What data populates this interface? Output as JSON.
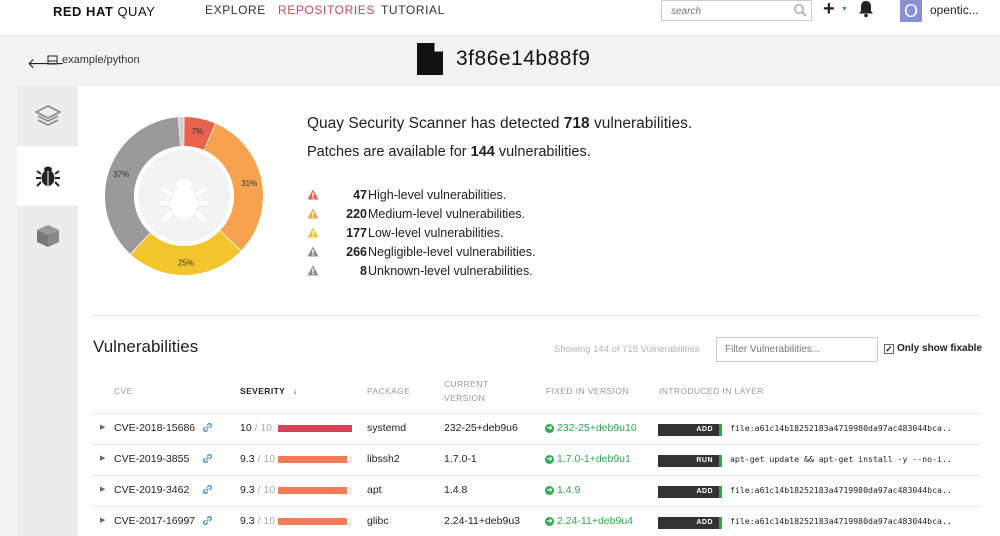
{
  "nav": {
    "brand_bold": "RED HAT",
    "brand_light": "QUAY",
    "links": [
      {
        "label": "EXPLORE",
        "active": false
      },
      {
        "label": "REPOSITORIES",
        "active": true
      },
      {
        "label": "TUTORIAL",
        "active": false
      }
    ],
    "search_placeholder": "search",
    "plus": "+",
    "avatar_letter": "O",
    "username": "opentic..."
  },
  "breadcrumb": {
    "repo": "example/python"
  },
  "tag": {
    "id": "3f86e14b88f9"
  },
  "summary": {
    "headline_prefix": "Quay Security Scanner has detected",
    "total": "718",
    "headline_suffix": "vulnerabilities.",
    "patches_prefix": "Patches are available for",
    "patches": "144",
    "patches_suffix": "vulnerabilities.",
    "levels": [
      {
        "count": "47",
        "label": "High-level vulnerabilities.",
        "color": "#e8624e"
      },
      {
        "count": "220",
        "label": "Medium-level vulnerabilities.",
        "color": "#f7a24f"
      },
      {
        "count": "177",
        "label": "Low-level vulnerabilities.",
        "color": "#f2c52d"
      },
      {
        "count": "266",
        "label": "Negligible-level vulnerabilities.",
        "color": "#8c8c8c"
      },
      {
        "count": "8",
        "label": "Unknown-level vulnerabilities.",
        "color": "#8c8c8c"
      }
    ]
  },
  "chart_data": {
    "type": "pie",
    "slices": [
      {
        "label": "7%",
        "value": 47,
        "color": "#e8624e"
      },
      {
        "label": "31%",
        "value": 220,
        "color": "#f7a24f"
      },
      {
        "label": "25%",
        "value": 177,
        "color": "#f2c52d"
      },
      {
        "label": "37%",
        "value": 266,
        "color": "#9a9a9a"
      },
      {
        "label": "",
        "value": 8,
        "color": "#cfcfcf"
      }
    ]
  },
  "vulns": {
    "title": "Vulnerabilities",
    "showing": "Showing 144 of 718 Vulnerabilities",
    "filter_placeholder": "Filter Vulnerabilities...",
    "fixable_label": "Only show fixable",
    "columns": {
      "cve": "CVE",
      "severity": "SEVERITY",
      "package": "PACKAGE",
      "current_1": "CURRENT",
      "current_2": "VERSION",
      "fixed": "FIXED IN VERSION",
      "layer": "INTRODUCED IN LAYER"
    },
    "rows": [
      {
        "cve": "CVE-2018-15686",
        "score": "10",
        "den": " / 10",
        "fill": 1.0,
        "color": "#d9435a",
        "package": "systemd",
        "current": "232-25+deb9u6",
        "fixed": "232-25+deb9u10",
        "layer_type": "ADD",
        "layer_cmd": "file:a61c14b18252183a4719980da97ac483044bca..."
      },
      {
        "cve": "CVE-2019-3855",
        "score": "9.3",
        "den": " / 10",
        "fill": 0.93,
        "color": "#f07c5a",
        "package": "libssh2",
        "current": "1.7.0-1",
        "fixed": "1.7.0-1+deb9u1",
        "layer_type": "RUN",
        "layer_cmd": "apt-get update && apt-get install -y --no-i..."
      },
      {
        "cve": "CVE-2019-3462",
        "score": "9.3",
        "den": " / 10",
        "fill": 0.93,
        "color": "#f07c5a",
        "package": "apt",
        "current": "1.4.8",
        "fixed": "1.4.9",
        "layer_type": "ADD",
        "layer_cmd": "file:a61c14b18252183a4719980da97ac483044bca..."
      },
      {
        "cve": "CVE-2017-16997",
        "score": "9.3",
        "den": " / 10",
        "fill": 0.93,
        "color": "#f07c5a",
        "package": "glibc",
        "current": "2.24-11+deb9u3",
        "fixed": "2.24-11+deb9u4",
        "layer_type": "ADD",
        "layer_cmd": "file:a61c14b18252183a4719980da97ac483044bca..."
      }
    ]
  }
}
